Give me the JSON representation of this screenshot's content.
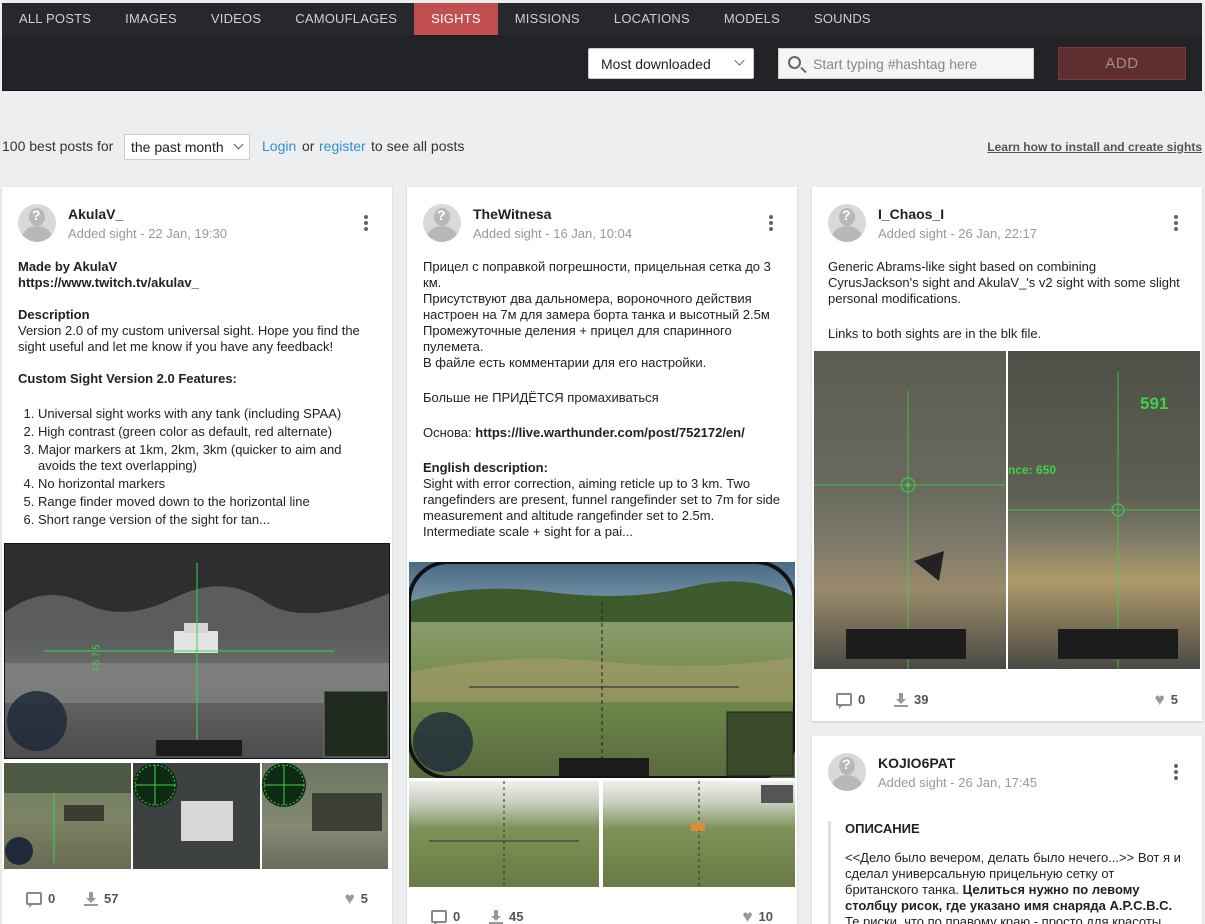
{
  "nav": {
    "tabs": [
      {
        "label": "ALL POSTS",
        "active": false
      },
      {
        "label": "IMAGES",
        "active": false
      },
      {
        "label": "VIDEOS",
        "active": false
      },
      {
        "label": "CAMOUFLAGES",
        "active": false
      },
      {
        "label": "SIGHTS",
        "active": true
      },
      {
        "label": "MISSIONS",
        "active": false
      },
      {
        "label": "LOCATIONS",
        "active": false
      },
      {
        "label": "MODELS",
        "active": false
      },
      {
        "label": "SOUNDS",
        "active": false
      }
    ],
    "sort_value": "Most downloaded",
    "search_placeholder": "Start typing #hashtag here",
    "add_label": "ADD"
  },
  "filter": {
    "prefix": "100 best posts for",
    "period": "the past month",
    "login": "Login",
    "or": "or",
    "register": "register",
    "suffix": "to see all posts",
    "learn": "Learn how to install and create sights"
  },
  "posts": [
    {
      "user": "AkulaV_",
      "meta": "Added sight - 22 Jan, 19:30",
      "made_by": "Made by AkulaV",
      "link": "https://www.twitch.tv/akulav_",
      "desc_heading": "Description",
      "desc_text": "Version 2.0 of my custom universal sight. Hope you find the sight useful and let me know if you have any feedback!",
      "features_heading": "Custom Sight Version 2.0 Features:",
      "features": [
        "Universal sight works with any tank (including SPAA)",
        "High contrast (green color as default, red alternate)",
        "Major markers at 1km, 2km, 3km (quicker to aim and avoids the text overlapping)",
        "No horizontal markers",
        "Range finder moved down to the horizontal line",
        "Short range version of the sight for tan..."
      ],
      "comments": "0",
      "downloads": "57",
      "likes": "5"
    },
    {
      "user": "TheWitnesa",
      "meta": "Added sight - 16 Jan, 10:04",
      "ru_lines": [
        "Прицел с поправкой погрешности, прицельная сетка до 3 км.",
        "Присутствуют два дальномера, вороночного действия настроен на 7м для замера борта танка и высотный 2.5м",
        "Промежуточные деления + прицел для спаринного пулемета.",
        "В файле есть комментарии для его настройки."
      ],
      "ru_no_miss": "Больше не ПРИДЁТСЯ промахиваться",
      "basis_label": "Основа: ",
      "basis_link": "https://live.warthunder.com/post/752172/en/",
      "en_heading": "English description:",
      "en_text": "Sight with error correction, aiming reticle up to 3 km. Two rangefinders are present, funnel rangefinder set to 7m for side measurement and altitude rangefinder set to 2.5m. Intermediate scale + sight for a pai...",
      "comments": "0",
      "downloads": "45",
      "likes": "10"
    },
    {
      "user": "I_Chaos_I",
      "meta": "Added sight - 26 Jan, 22:17",
      "text1": "Generic Abrams-like sight based on combining CyrusJackson's sight and AkulaV_'s v2 sight with some slight personal modifications.",
      "text2": "Links to both sights are in the blk file.",
      "hud_range": "591",
      "hud_dist": "nce: 650",
      "comments": "0",
      "downloads": "39",
      "likes": "5"
    },
    {
      "user": "KOJIO6PAT",
      "meta": "Added sight - 26 Jan, 17:45",
      "heading": "ОПИСАНИЕ",
      "text_normal": "<<Дело было вечером, делать было нечего...>> Вот я и сделал универсальную прицельную сетку от британского танка. ",
      "text_bold": "Целиться нужно по левому столбцу рисок, где указано имя снаряда A.P.C.B.C.",
      "text_tail": " Те риски, что по правому краю - просто для красоты."
    }
  ],
  "colors": {
    "accent": "#c24f4f",
    "link": "#2e8fd1",
    "nav_bg": "#222326",
    "add_button": "#5e2e30",
    "reticle": "#3fd24a"
  }
}
